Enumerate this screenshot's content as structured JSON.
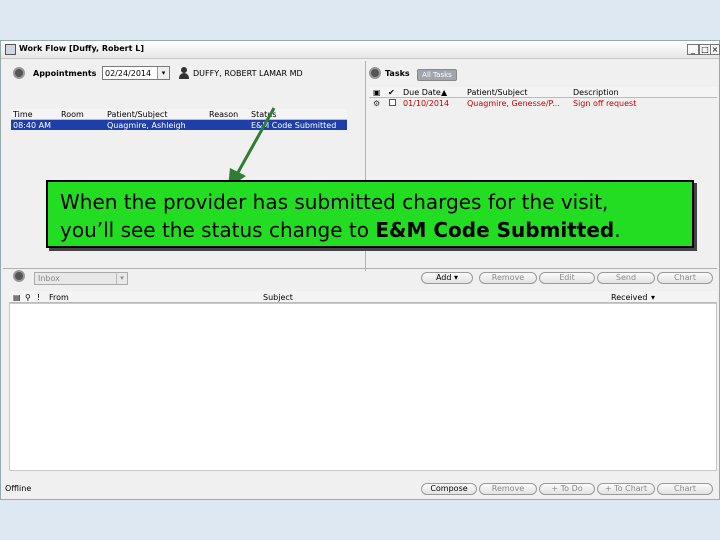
{
  "window": {
    "title": "Work Flow [Duffy, Robert L]",
    "min": "_",
    "max": "□",
    "close": "×"
  },
  "appointments": {
    "label": "Appointments",
    "date": "02/24/2014",
    "date_dropdown": "▾",
    "provider": "DUFFY, ROBERT LAMAR MD",
    "columns": [
      "Time",
      "Room",
      "Patient/Subject",
      "Reason",
      "Status"
    ],
    "rows": [
      {
        "time": "08:40 AM",
        "room": "",
        "patient": "Quagmire, Ashleigh",
        "reason": "",
        "status": "E&M Code Submitted"
      }
    ]
  },
  "tasks": {
    "label": "Tasks",
    "filter": "All Tasks",
    "columns": [
      "Due Date",
      "Patient/Subject",
      "Description"
    ],
    "sort_indicator": "▲",
    "rows": [
      {
        "due": "01/10/2014",
        "patient": "Quagmire, Genesse/P...",
        "description": "Sign off request"
      }
    ]
  },
  "callout": {
    "line1": "When the provider has submitted charges for the visit,",
    "line2_prefix": "you’ll see the status change to ",
    "line2_bold": "E&M Code Submitted",
    "line2_suffix": "."
  },
  "inbox": {
    "folder": "Inbox",
    "dropdown": "▾",
    "buttons": {
      "add": "Add",
      "add_dropdown": "▾",
      "remove": "Remove",
      "edit": "Edit",
      "send": "Send",
      "chart": "Chart"
    },
    "columns": {
      "from": "From",
      "subject": "Subject",
      "received": "Received",
      "received_sort": "▾"
    }
  },
  "footer": {
    "status": "Offline",
    "buttons": {
      "compose": "Compose",
      "remove": "Remove",
      "todo": "+ To Do",
      "tochart": "+ To Chart",
      "chart": "Chart"
    }
  }
}
